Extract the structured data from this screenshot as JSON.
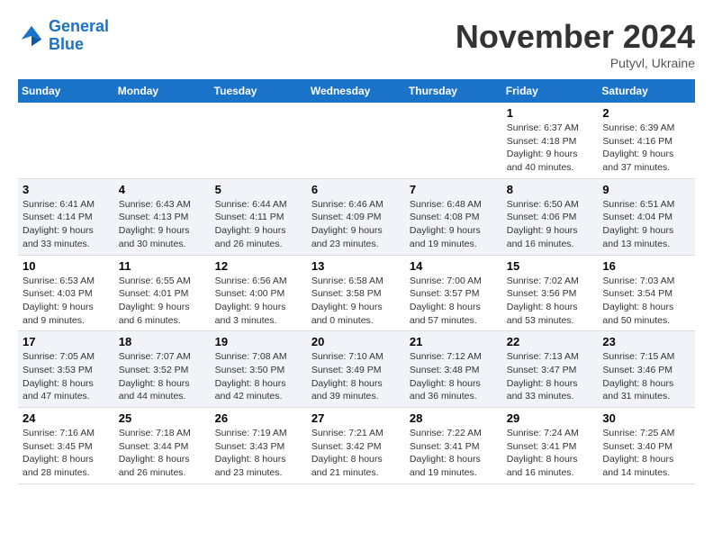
{
  "header": {
    "logo_line1": "General",
    "logo_line2": "Blue",
    "month": "November 2024",
    "location": "Putyvl, Ukraine"
  },
  "weekdays": [
    "Sunday",
    "Monday",
    "Tuesday",
    "Wednesday",
    "Thursday",
    "Friday",
    "Saturday"
  ],
  "weeks": [
    [
      {
        "day": "",
        "info": ""
      },
      {
        "day": "",
        "info": ""
      },
      {
        "day": "",
        "info": ""
      },
      {
        "day": "",
        "info": ""
      },
      {
        "day": "",
        "info": ""
      },
      {
        "day": "1",
        "info": "Sunrise: 6:37 AM\nSunset: 4:18 PM\nDaylight: 9 hours and 40 minutes."
      },
      {
        "day": "2",
        "info": "Sunrise: 6:39 AM\nSunset: 4:16 PM\nDaylight: 9 hours and 37 minutes."
      }
    ],
    [
      {
        "day": "3",
        "info": "Sunrise: 6:41 AM\nSunset: 4:14 PM\nDaylight: 9 hours and 33 minutes."
      },
      {
        "day": "4",
        "info": "Sunrise: 6:43 AM\nSunset: 4:13 PM\nDaylight: 9 hours and 30 minutes."
      },
      {
        "day": "5",
        "info": "Sunrise: 6:44 AM\nSunset: 4:11 PM\nDaylight: 9 hours and 26 minutes."
      },
      {
        "day": "6",
        "info": "Sunrise: 6:46 AM\nSunset: 4:09 PM\nDaylight: 9 hours and 23 minutes."
      },
      {
        "day": "7",
        "info": "Sunrise: 6:48 AM\nSunset: 4:08 PM\nDaylight: 9 hours and 19 minutes."
      },
      {
        "day": "8",
        "info": "Sunrise: 6:50 AM\nSunset: 4:06 PM\nDaylight: 9 hours and 16 minutes."
      },
      {
        "day": "9",
        "info": "Sunrise: 6:51 AM\nSunset: 4:04 PM\nDaylight: 9 hours and 13 minutes."
      }
    ],
    [
      {
        "day": "10",
        "info": "Sunrise: 6:53 AM\nSunset: 4:03 PM\nDaylight: 9 hours and 9 minutes."
      },
      {
        "day": "11",
        "info": "Sunrise: 6:55 AM\nSunset: 4:01 PM\nDaylight: 9 hours and 6 minutes."
      },
      {
        "day": "12",
        "info": "Sunrise: 6:56 AM\nSunset: 4:00 PM\nDaylight: 9 hours and 3 minutes."
      },
      {
        "day": "13",
        "info": "Sunrise: 6:58 AM\nSunset: 3:58 PM\nDaylight: 9 hours and 0 minutes."
      },
      {
        "day": "14",
        "info": "Sunrise: 7:00 AM\nSunset: 3:57 PM\nDaylight: 8 hours and 57 minutes."
      },
      {
        "day": "15",
        "info": "Sunrise: 7:02 AM\nSunset: 3:56 PM\nDaylight: 8 hours and 53 minutes."
      },
      {
        "day": "16",
        "info": "Sunrise: 7:03 AM\nSunset: 3:54 PM\nDaylight: 8 hours and 50 minutes."
      }
    ],
    [
      {
        "day": "17",
        "info": "Sunrise: 7:05 AM\nSunset: 3:53 PM\nDaylight: 8 hours and 47 minutes."
      },
      {
        "day": "18",
        "info": "Sunrise: 7:07 AM\nSunset: 3:52 PM\nDaylight: 8 hours and 44 minutes."
      },
      {
        "day": "19",
        "info": "Sunrise: 7:08 AM\nSunset: 3:50 PM\nDaylight: 8 hours and 42 minutes."
      },
      {
        "day": "20",
        "info": "Sunrise: 7:10 AM\nSunset: 3:49 PM\nDaylight: 8 hours and 39 minutes."
      },
      {
        "day": "21",
        "info": "Sunrise: 7:12 AM\nSunset: 3:48 PM\nDaylight: 8 hours and 36 minutes."
      },
      {
        "day": "22",
        "info": "Sunrise: 7:13 AM\nSunset: 3:47 PM\nDaylight: 8 hours and 33 minutes."
      },
      {
        "day": "23",
        "info": "Sunrise: 7:15 AM\nSunset: 3:46 PM\nDaylight: 8 hours and 31 minutes."
      }
    ],
    [
      {
        "day": "24",
        "info": "Sunrise: 7:16 AM\nSunset: 3:45 PM\nDaylight: 8 hours and 28 minutes."
      },
      {
        "day": "25",
        "info": "Sunrise: 7:18 AM\nSunset: 3:44 PM\nDaylight: 8 hours and 26 minutes."
      },
      {
        "day": "26",
        "info": "Sunrise: 7:19 AM\nSunset: 3:43 PM\nDaylight: 8 hours and 23 minutes."
      },
      {
        "day": "27",
        "info": "Sunrise: 7:21 AM\nSunset: 3:42 PM\nDaylight: 8 hours and 21 minutes."
      },
      {
        "day": "28",
        "info": "Sunrise: 7:22 AM\nSunset: 3:41 PM\nDaylight: 8 hours and 19 minutes."
      },
      {
        "day": "29",
        "info": "Sunrise: 7:24 AM\nSunset: 3:41 PM\nDaylight: 8 hours and 16 minutes."
      },
      {
        "day": "30",
        "info": "Sunrise: 7:25 AM\nSunset: 3:40 PM\nDaylight: 8 hours and 14 minutes."
      }
    ]
  ]
}
